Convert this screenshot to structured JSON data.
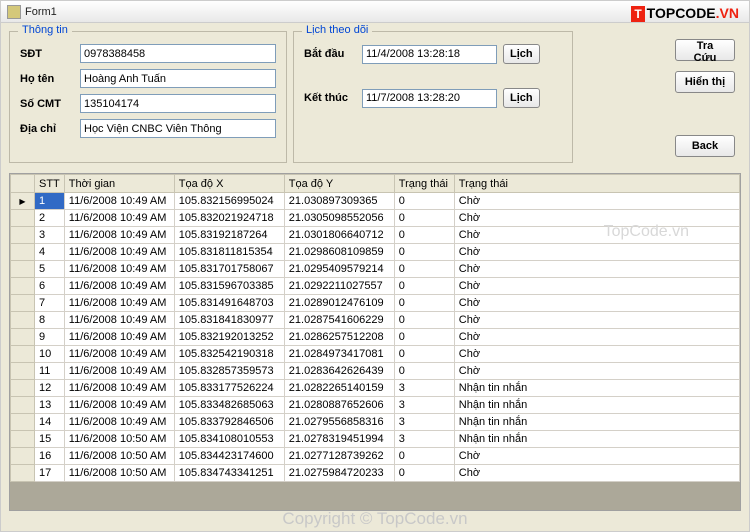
{
  "window": {
    "title": "Form1"
  },
  "branding": {
    "logo_prefix_box": "T",
    "logo_text": "TOPCODE",
    "logo_suffix": ".VN"
  },
  "watermark": {
    "text": "TopCode.vn",
    "copyright": "Copyright © TopCode.vn"
  },
  "info_group": {
    "legend": "Thông tin",
    "fields": {
      "phone": {
        "label": "SĐT",
        "value": "0978388458"
      },
      "name": {
        "label": "Họ tên",
        "value": "Hoàng Anh Tuấn"
      },
      "cmt": {
        "label": "Số CMT",
        "value": "135104174"
      },
      "addr": {
        "label": "Địa chỉ",
        "value": "Học Viện CNBC Viễn Thông"
      }
    }
  },
  "track_group": {
    "legend": "Lịch theo dõi",
    "start": {
      "label": "Bắt đầu",
      "value": "11/4/2008 13:28:18",
      "button": "Lịch"
    },
    "end": {
      "label": "Kết thúc",
      "value": "11/7/2008 13:28:20",
      "button": "Lịch"
    }
  },
  "side_buttons": {
    "lookup": "Tra Cứu",
    "display": "Hiển thị",
    "back": "Back"
  },
  "grid": {
    "columns": [
      "STT",
      "Thời gian",
      "Tọa độ X",
      "Tọa độ Y",
      "Trạng thái",
      "Trạng thái"
    ],
    "rows": [
      {
        "stt": "1",
        "time": "11/6/2008 10:49 AM",
        "x": "105.832156995024",
        "y": "21.030897309365",
        "s1": "0",
        "s2": "Chờ"
      },
      {
        "stt": "2",
        "time": "11/6/2008 10:49 AM",
        "x": "105.832021924718",
        "y": "21.0305098552056",
        "s1": "0",
        "s2": "Chờ"
      },
      {
        "stt": "3",
        "time": "11/6/2008 10:49 AM",
        "x": "105.83192187264",
        "y": "21.0301806640712",
        "s1": "0",
        "s2": "Chờ"
      },
      {
        "stt": "4",
        "time": "11/6/2008 10:49 AM",
        "x": "105.831811815354",
        "y": "21.0298608109859",
        "s1": "0",
        "s2": "Chờ"
      },
      {
        "stt": "5",
        "time": "11/6/2008 10:49 AM",
        "x": "105.831701758067",
        "y": "21.0295409579214",
        "s1": "0",
        "s2": "Chờ"
      },
      {
        "stt": "6",
        "time": "11/6/2008 10:49 AM",
        "x": "105.831596703385",
        "y": "21.0292211027557",
        "s1": "0",
        "s2": "Chờ"
      },
      {
        "stt": "7",
        "time": "11/6/2008 10:49 AM",
        "x": "105.831491648703",
        "y": "21.0289012476109",
        "s1": "0",
        "s2": "Chờ"
      },
      {
        "stt": "8",
        "time": "11/6/2008 10:49 AM",
        "x": "105.831841830977",
        "y": "21.0287541606229",
        "s1": "0",
        "s2": "Chờ"
      },
      {
        "stt": "9",
        "time": "11/6/2008 10:49 AM",
        "x": "105.832192013252",
        "y": "21.0286257512208",
        "s1": "0",
        "s2": "Chờ"
      },
      {
        "stt": "10",
        "time": "11/6/2008 10:49 AM",
        "x": "105.832542190318",
        "y": "21.0284973417081",
        "s1": "0",
        "s2": "Chờ"
      },
      {
        "stt": "11",
        "time": "11/6/2008 10:49 AM",
        "x": "105.832857359573",
        "y": "21.0283642626439",
        "s1": "0",
        "s2": "Chờ"
      },
      {
        "stt": "12",
        "time": "11/6/2008 10:49 AM",
        "x": "105.833177526224",
        "y": "21.0282265140159",
        "s1": "3",
        "s2": "Nhận tin nhắn"
      },
      {
        "stt": "13",
        "time": "11/6/2008 10:49 AM",
        "x": "105.833482685063",
        "y": "21.0280887652606",
        "s1": "3",
        "s2": "Nhận tin nhắn"
      },
      {
        "stt": "14",
        "time": "11/6/2008 10:49 AM",
        "x": "105.833792846506",
        "y": "21.0279556858316",
        "s1": "3",
        "s2": "Nhận tin nhắn"
      },
      {
        "stt": "15",
        "time": "11/6/2008 10:50 AM",
        "x": "105.834108010553",
        "y": "21.0278319451994",
        "s1": "3",
        "s2": "Nhận tin nhắn"
      },
      {
        "stt": "16",
        "time": "11/6/2008 10:50 AM",
        "x": "105.834423174600",
        "y": "21.0277128739262",
        "s1": "0",
        "s2": "Chờ"
      },
      {
        "stt": "17",
        "time": "11/6/2008 10:50 AM",
        "x": "105.834743341251",
        "y": "21.0275984720233",
        "s1": "0",
        "s2": "Chờ"
      }
    ]
  }
}
